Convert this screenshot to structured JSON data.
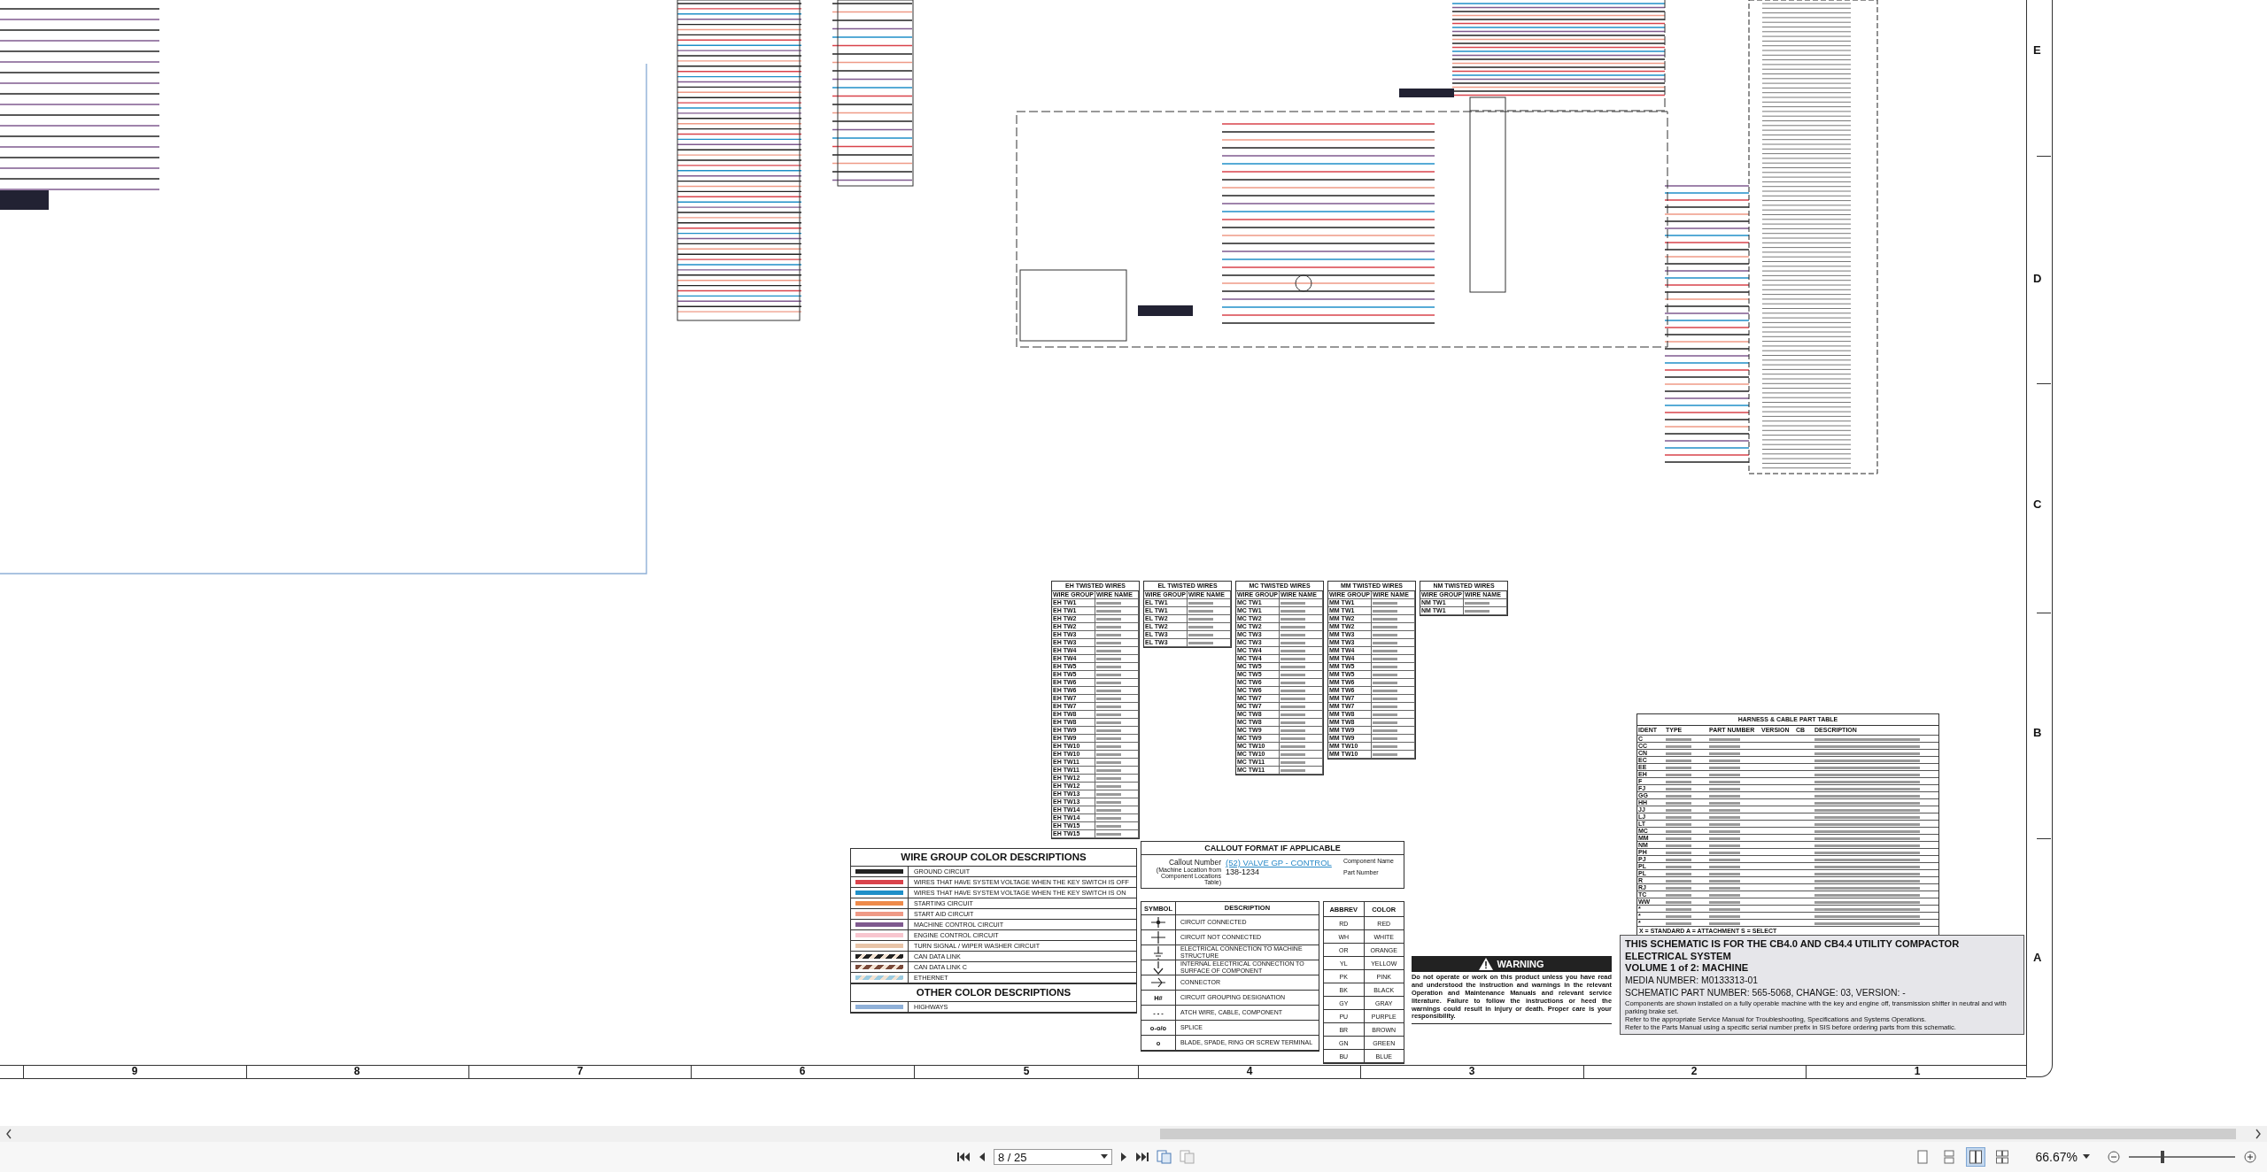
{
  "schematic": {
    "row_labels": [
      "E",
      "D",
      "C",
      "B",
      "A"
    ],
    "column_labels": [
      "9",
      "8",
      "7",
      "6",
      "5",
      "4",
      "3",
      "2",
      "1"
    ]
  },
  "twisted_wire_tables": [
    {
      "title": "EH TWISTED WIRES",
      "columns": [
        "WIRE GROUP",
        "WIRE NAME"
      ],
      "groups": [
        "EH TW1",
        "EH TW1",
        "EH TW2",
        "EH TW2",
        "EH TW3",
        "EH TW3",
        "EH TW4",
        "EH TW4",
        "EH TW5",
        "EH TW5",
        "EH TW6",
        "EH TW6",
        "EH TW7",
        "EH TW7",
        "EH TW8",
        "EH TW8",
        "EH TW9",
        "EH TW9",
        "EH TW10",
        "EH TW10",
        "EH TW11",
        "EH TW11",
        "EH TW12",
        "EH TW12",
        "EH TW13",
        "EH TW13",
        "EH TW14",
        "EH TW14",
        "EH TW15",
        "EH TW15"
      ]
    },
    {
      "title": "EL TWISTED WIRES",
      "columns": [
        "WIRE GROUP",
        "WIRE NAME"
      ],
      "groups": [
        "EL TW1",
        "EL TW1",
        "EL TW2",
        "EL TW2",
        "EL TW3",
        "EL TW3"
      ]
    },
    {
      "title": "MC TWISTED WIRES",
      "columns": [
        "WIRE GROUP",
        "WIRE NAME"
      ],
      "groups": [
        "MC TW1",
        "MC TW1",
        "MC TW2",
        "MC TW2",
        "MC TW3",
        "MC TW3",
        "MC TW4",
        "MC TW4",
        "MC TW5",
        "MC TW5",
        "MC TW6",
        "MC TW6",
        "MC TW7",
        "MC TW7",
        "MC TW8",
        "MC TW8",
        "MC TW9",
        "MC TW9",
        "MC TW10",
        "MC TW10",
        "MC TW11",
        "MC TW11"
      ]
    },
    {
      "title": "MM TWISTED WIRES",
      "columns": [
        "WIRE GROUP",
        "WIRE NAME"
      ],
      "groups": [
        "MM TW1",
        "MM TW1",
        "MM TW2",
        "MM TW2",
        "MM TW3",
        "MM TW3",
        "MM TW4",
        "MM TW4",
        "MM TW5",
        "MM TW5",
        "MM TW6",
        "MM TW6",
        "MM TW7",
        "MM TW7",
        "MM TW8",
        "MM TW8",
        "MM TW9",
        "MM TW9",
        "MM TW10",
        "MM TW10"
      ]
    },
    {
      "title": "NM TWISTED WIRES",
      "columns": [
        "WIRE GROUP",
        "WIRE NAME"
      ],
      "groups": [
        "NM TW1",
        "NM TW1"
      ]
    }
  ],
  "harness_table": {
    "title": "HARNESS & CABLE PART TABLE",
    "columns": [
      "IDENT",
      "TYPE",
      "PART NUMBER",
      "VERSION",
      "CB",
      "DESCRIPTION"
    ],
    "idents": [
      "C",
      "CC",
      "CN",
      "EC",
      "EE",
      "EH",
      "F",
      "FJ",
      "GG",
      "HH",
      "JJ",
      "LJ",
      "LT",
      "MC",
      "MM",
      "NM",
      "PH",
      "PJ",
      "PL",
      "PL",
      "R",
      "RJ",
      "TC",
      "WW",
      "*",
      "*",
      "*"
    ],
    "footnote": "X = STANDARD   A = ATTACHMENT   S = SELECT"
  },
  "wire_group_colors": {
    "title": "WIRE GROUP COLOR DESCRIPTIONS",
    "items": [
      {
        "label": "GROUND CIRCUIT",
        "color": "#222222",
        "kind": "solid"
      },
      {
        "label": "WIRES THAT HAVE SYSTEM VOLTAGE WHEN THE KEY SWITCH IS OFF",
        "color": "#d9434b",
        "kind": "solid"
      },
      {
        "label": "WIRES THAT HAVE SYSTEM VOLTAGE WHEN THE KEY SWITCH IS ON",
        "color": "#1f8fc8",
        "kind": "solid"
      },
      {
        "label": "STARTING CIRCUIT",
        "color": "#ee8a4a",
        "kind": "solid"
      },
      {
        "label": "START AID CIRCUIT",
        "color": "#ef9a86",
        "kind": "solid"
      },
      {
        "label": "MACHINE CONTROL CIRCUIT",
        "color": "#7f5a8f",
        "kind": "solid"
      },
      {
        "label": "ENGINE CONTROL CIRCUIT",
        "color": "#f8c6cf",
        "kind": "solid"
      },
      {
        "label": "TURN SIGNAL / WIPER WASHER CIRCUIT",
        "color": "#e8c4a8",
        "kind": "solid"
      },
      {
        "label": "CAN DATA LINK",
        "color": "#222222",
        "kind": "striped"
      },
      {
        "label": "CAN DATA LINK C",
        "color": "#7a4a3a",
        "kind": "striped"
      },
      {
        "label": "ETHERNET",
        "color": "#9ccbe0",
        "kind": "striped"
      }
    ]
  },
  "other_colors": {
    "title": "OTHER COLOR DESCRIPTIONS",
    "items": [
      {
        "label": "HIGHWAYS",
        "color": "#8fb0d8",
        "kind": "solid"
      }
    ]
  },
  "callout": {
    "title": "CALLOUT FORMAT IF APPLICABLE",
    "callout_number": "Callout Number",
    "callout_note": "(Machine Location from Component Locations Table)",
    "component_link": "(52) VALVE GP - CONTROL",
    "component_name_label": "Component Name",
    "part_number": "138-1234",
    "part_number_label": "Part Number"
  },
  "symbols": {
    "columns": [
      "SYMBOL",
      "DESCRIPTION"
    ],
    "rows": [
      {
        "kind": "connected",
        "description": "CIRCUIT CONNECTED"
      },
      {
        "kind": "cross",
        "description": "CIRCUIT NOT CONNECTED"
      },
      {
        "kind": "ground",
        "description": "ELECTRICAL CONNECTION TO MACHINE STRUCTURE"
      },
      {
        "kind": "ground-internal",
        "description": "INTERNAL ELECTRICAL CONNECTION TO SURFACE OF COMPONENT"
      },
      {
        "kind": "connector",
        "description": "CONNECTOR"
      },
      {
        "kind": "text",
        "symbol": "H#",
        "description": "CIRCUIT GROUPING DESIGNATION"
      },
      {
        "kind": "text",
        "symbol": "- - -",
        "description": "ATCH WIRE, CABLE, COMPONENT"
      },
      {
        "kind": "text",
        "symbol": "o-o/o",
        "description": "SPLICE"
      },
      {
        "kind": "text",
        "symbol": "o",
        "description": "BLADE, SPADE, RING OR SCREW TERMINAL"
      }
    ]
  },
  "abbreviations": {
    "columns": [
      "ABBREV",
      "COLOR"
    ],
    "rows": [
      {
        "abbrev": "RD",
        "name": "RED"
      },
      {
        "abbrev": "WH",
        "name": "WHITE"
      },
      {
        "abbrev": "OR",
        "name": "ORANGE"
      },
      {
        "abbrev": "YL",
        "name": "YELLOW"
      },
      {
        "abbrev": "PK",
        "name": "PINK"
      },
      {
        "abbrev": "BK",
        "name": "BLACK"
      },
      {
        "abbrev": "GY",
        "name": "GRAY"
      },
      {
        "abbrev": "PU",
        "name": "PURPLE"
      },
      {
        "abbrev": "BR",
        "name": "BROWN"
      },
      {
        "abbrev": "GN",
        "name": "GREEN"
      },
      {
        "abbrev": "BU",
        "name": "BLUE"
      }
    ]
  },
  "warning": {
    "title": "WARNING",
    "text": "Do not operate or work on this product unless you have read and understood the instruction and warnings in the relevant Operation and Maintenance Manuals and relevant service literature. Failure to follow the instructions or heed the warnings could result in injury or death. Proper care is your responsibility."
  },
  "title_block": {
    "lines": [
      {
        "kind": "heading",
        "text": "THIS SCHEMATIC IS FOR THE CB4.0 AND CB4.4 UTILITY COMPACTOR ELECTRICAL SYSTEM"
      },
      {
        "kind": "heading",
        "text": "VOLUME 1 of 2: MACHINE"
      },
      {
        "kind": "medium",
        "text": "MEDIA NUMBER: M0133313-01"
      },
      {
        "kind": "medium",
        "text": "SCHEMATIC PART NUMBER: 565-5068, CHANGE: 03, VERSION: -"
      },
      {
        "kind": "note",
        "text": "Components are shown installed on a fully operable machine with the key and engine off, transmission shifter in neutral and with parking brake set."
      },
      {
        "kind": "note",
        "text": "Refer to the appropriate Service Manual for Troubleshooting, Specifications and Systems Operations."
      },
      {
        "kind": "note",
        "text": "Refer to the Parts Manual using a specific serial number prefix in SIS before ordering parts from this schematic."
      }
    ]
  },
  "toolbar": {
    "page": "8 / 25",
    "zoom": "66.67%",
    "zoom_level": {
      "level": 0.32
    },
    "view_modes": [
      {
        "kind": "single",
        "selected": false
      },
      {
        "kind": "continuous",
        "selected": false
      },
      {
        "kind": "facing",
        "selected": true
      },
      {
        "kind": "facing-continuous",
        "selected": false
      }
    ]
  }
}
